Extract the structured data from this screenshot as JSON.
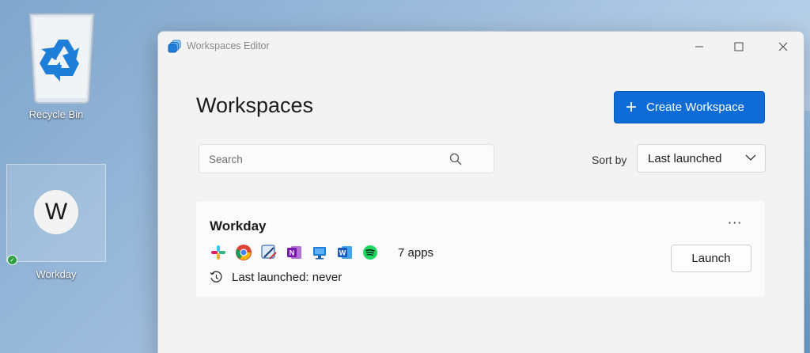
{
  "desktop": {
    "recycle_bin_label": "Recycle Bin",
    "workspace_shortcut": {
      "letter": "W",
      "label": "Workday"
    }
  },
  "window": {
    "title": "Workspaces Editor",
    "controls": {
      "minimize": "–",
      "maximize": "☐",
      "close": "✕"
    }
  },
  "header": {
    "title": "Workspaces",
    "create_button": {
      "icon": "plus-icon",
      "label": "Create Workspace"
    }
  },
  "search": {
    "placeholder": "Search",
    "value": ""
  },
  "sort": {
    "label": "Sort by",
    "selected": "Last launched"
  },
  "workspaces": [
    {
      "name": "Workday",
      "more": "···",
      "apps": [
        "slack-icon",
        "chrome-icon",
        "snipping-tool-icon",
        "onenote-icon",
        "remote-desktop-icon",
        "word-icon",
        "spotify-icon"
      ],
      "apps_count": "7 apps",
      "last_launched": "Last launched: never",
      "launch_label": "Launch"
    }
  ],
  "colors": {
    "accent": "#0f6cd6",
    "window_bg": "#f3f3f3",
    "card_bg": "#fbfbfb"
  }
}
